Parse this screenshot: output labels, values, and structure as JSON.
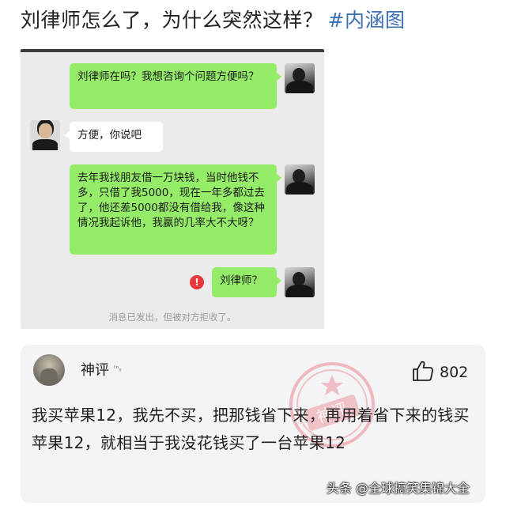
{
  "post": {
    "title": "刘律师怎么了，为什么突然这样？",
    "hashtag": "#内涵图"
  },
  "chat": {
    "messages": [
      {
        "side": "right",
        "text": "刘律师在吗？我想咨询个问题方便吗？"
      },
      {
        "side": "left",
        "text": "方便，你说吧"
      },
      {
        "side": "right",
        "text": "去年我找朋友借一万块钱，当时他钱不多，只借了我5000，现在一年多都过去了，他还差5000都没有借给我，像这种情况我起诉他，我赢的几率大不大呀？"
      },
      {
        "side": "right",
        "text": "刘律师？",
        "failed": true
      }
    ],
    "error_mark": "!",
    "system_note": "消息已发出，但被对方拒收了。"
  },
  "comment": {
    "author": "神评",
    "author_mark": "ᶠᵒᵧ",
    "likes": "802",
    "stamp_text": "神评",
    "text": "我买苹果12，我先不买，把那钱省下来，再用着省下来的钱买苹果12，就相当于我没花钱买了一台苹果12"
  },
  "watermark": "头条 @全球搞笑集锦大全",
  "colors": {
    "chat_bg": "#ebebeb",
    "green_bubble": "#95ec69",
    "hashtag": "#3b6fb6",
    "error_red": "#e8393c",
    "comment_bg": "#f4f4f6",
    "stamp_pink": "#e9868f"
  },
  "icons": {
    "like": "thumbs-up-icon",
    "failed": "error-icon"
  }
}
